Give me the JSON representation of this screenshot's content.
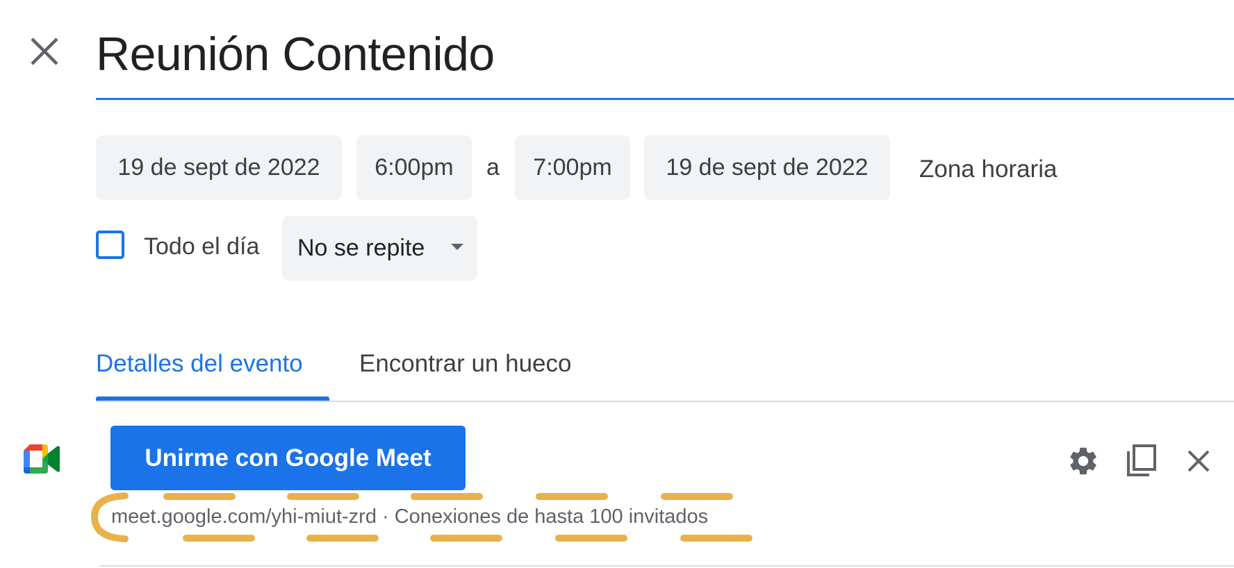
{
  "event": {
    "title": "Reunión Contenido",
    "start_date": "19 de sept de 2022",
    "start_time": "6:00pm",
    "separator": "a",
    "end_time": "7:00pm",
    "end_date": "19 de sept de 2022",
    "timezone_link": "Zona horaria",
    "all_day_label": "Todo el día",
    "all_day_checked": false,
    "repeat_selected": "No se repite"
  },
  "tabs": [
    {
      "label": "Detalles del evento",
      "active": true
    },
    {
      "label": "Encontrar un hueco",
      "active": false
    }
  ],
  "meet": {
    "join_button": "Unirme con Google Meet",
    "info": "meet.google.com/yhi-miut-zrd · Conexiones de hasta 100 invitados"
  },
  "icons": {
    "close": "close-icon",
    "meet_logo": "google-meet-icon",
    "settings": "gear-icon",
    "copy": "copy-icon",
    "remove_meet": "close-icon",
    "dropdown": "chevron-down-icon"
  },
  "colors": {
    "accent": "#1a73e8",
    "chip_bg": "#f1f3f4",
    "highlight": "#e8b24a"
  }
}
